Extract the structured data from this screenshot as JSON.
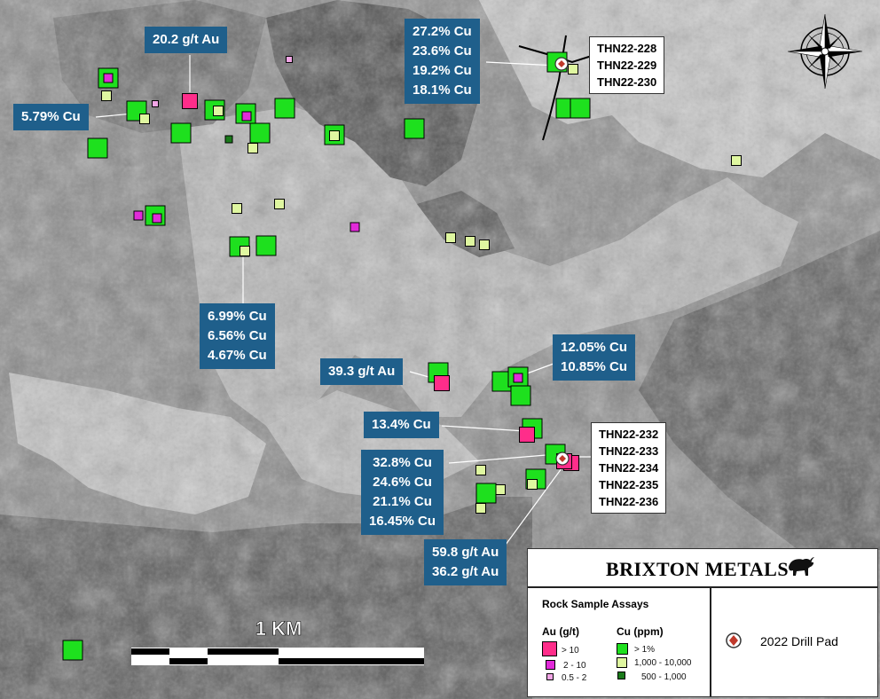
{
  "colors": {
    "au_high": "#ff2d8a",
    "au_mid": "#e12ad9",
    "au_low": "#f2a6e6",
    "cu_high": "#1ee01e",
    "cu_mid": "#dff7a0",
    "cu_low": "#1a7a1a",
    "callout_bg": "#1f5f8b",
    "drill_marker": "#c0392b"
  },
  "callouts": [
    {
      "id": "c1",
      "lines": [
        "20.2 g/t Au"
      ]
    },
    {
      "id": "c2",
      "lines": [
        "5.79% Cu"
      ]
    },
    {
      "id": "c3",
      "lines": [
        "27.2% Cu",
        "23.6% Cu",
        "19.2% Cu",
        "18.1% Cu"
      ]
    },
    {
      "id": "c4",
      "lines": [
        "6.99% Cu",
        "6.56% Cu",
        "4.67% Cu"
      ]
    },
    {
      "id": "c5",
      "lines": [
        "39.3 g/t Au"
      ]
    },
    {
      "id": "c6",
      "lines": [
        "12.05% Cu",
        "10.85% Cu"
      ]
    },
    {
      "id": "c7",
      "lines": [
        "13.4% Cu"
      ]
    },
    {
      "id": "c8",
      "lines": [
        "32.8% Cu",
        "24.6% Cu",
        "21.1% Cu",
        "16.45% Cu"
      ]
    },
    {
      "id": "c9",
      "lines": [
        "59.8 g/t Au",
        "36.2 g/t Au"
      ]
    }
  ],
  "drill_labels": [
    {
      "id": "d1",
      "lines": [
        "THN22-228",
        "THN22-229",
        "THN22-230"
      ]
    },
    {
      "id": "d2",
      "lines": [
        "THN22-232",
        "THN22-233",
        "THN22-234",
        "THN22-235",
        "THN22-236"
      ]
    }
  ],
  "scale": {
    "label": "1 KM"
  },
  "legend": {
    "company": "BRIXTON METALS",
    "title": "Rock Sample Assays",
    "au_header": "Au (g/t)",
    "cu_header": "Cu (ppm)",
    "au_items": [
      {
        "label": "> 10",
        "class": "au_high"
      },
      {
        "label": "2   - 10",
        "class": "au_mid"
      },
      {
        "label": "0.5 -  2",
        "class": "au_low"
      }
    ],
    "cu_items": [
      {
        "label": "> 1%",
        "class": "cu_high"
      },
      {
        "label": "1,000 - 10,000",
        "class": "cu_mid"
      },
      {
        "label": "500 -  1,000",
        "class": "cu_low"
      }
    ],
    "drill_pad_label": "2022 Drill Pad"
  },
  "icons": {
    "compass": "compass-rose-icon",
    "drill": "drill-pad-icon",
    "logo": "bull-logo-icon"
  }
}
